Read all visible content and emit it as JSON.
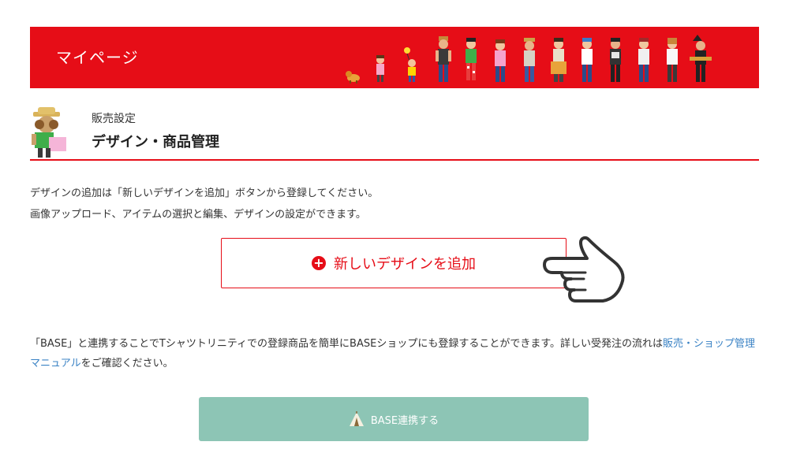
{
  "header": {
    "title": "マイページ",
    "illustration": "people-parade"
  },
  "section": {
    "subtitle": "販売設定",
    "title": "デザイン・商品管理",
    "icon": "mascot-illustration"
  },
  "intro": {
    "line1": "デザインの追加は「新しいデザインを追加」ボタンから登録してください。",
    "line2": "画像アップロード、アイテムの選択と編集、デザインの設定ができます。"
  },
  "add_button": {
    "label": "新しいデザインを追加",
    "icon": "plus-circle-icon",
    "pointer_icon": "pointing-hand-icon"
  },
  "base_info": {
    "text_before": "「BASE」と連携することでTシャツトリニティでの登録商品を簡単にBASEショップにも登録することができます。詳しい受発注の流れは",
    "link": "販売・ショップ管理マニュアル",
    "text_after": "をご確認ください。"
  },
  "base_button": {
    "label": "BASE連携する",
    "icon": "tent-icon"
  },
  "colors": {
    "brand_red": "#e60d17",
    "base_green": "#8dc5b5",
    "link_blue": "#3b83c5"
  }
}
